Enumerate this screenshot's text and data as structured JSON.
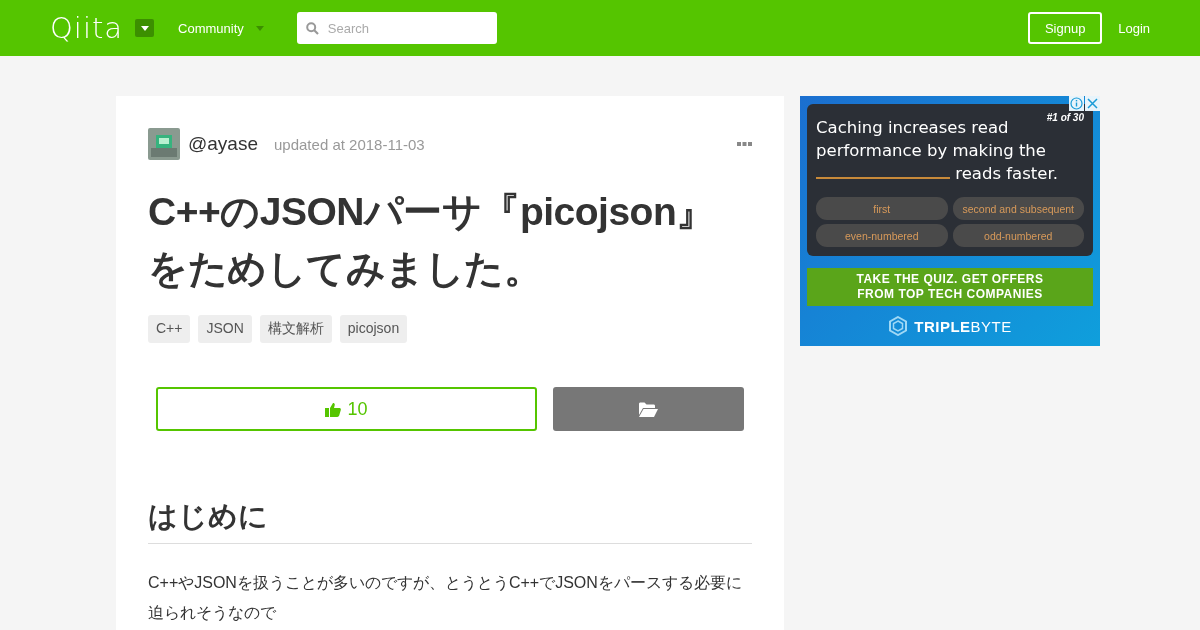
{
  "header": {
    "logo": "Qiita",
    "community": "Community",
    "search": {
      "placeholder": "Search"
    },
    "signup": "Signup",
    "login": "Login"
  },
  "article": {
    "author": "@ayase",
    "updated": "updated at 2018-11-03",
    "title": "C++のJSONパーサ『picojson』をためしてみました。",
    "tags": [
      "C++",
      "JSON",
      "構文解析",
      "picojson"
    ],
    "like_count": "10",
    "heading": "はじめに",
    "paragraph": "C++やJSONを扱うことが多いのですが、とうとうC++でJSONをパースする必要に迫られそうなので"
  },
  "ad": {
    "counter": "#1 of 30",
    "question_before": "Caching increases read performance by making the",
    "question_after": "reads faster.",
    "answers": [
      "first",
      "second and subsequent",
      "even-numbered",
      "odd-numbered"
    ],
    "cta": "TAKE THE QUIZ. GET OFFERS FROM TOP TECH COMPANIES",
    "brand_bold": "TRIPLE",
    "brand_light": "BYTE"
  }
}
